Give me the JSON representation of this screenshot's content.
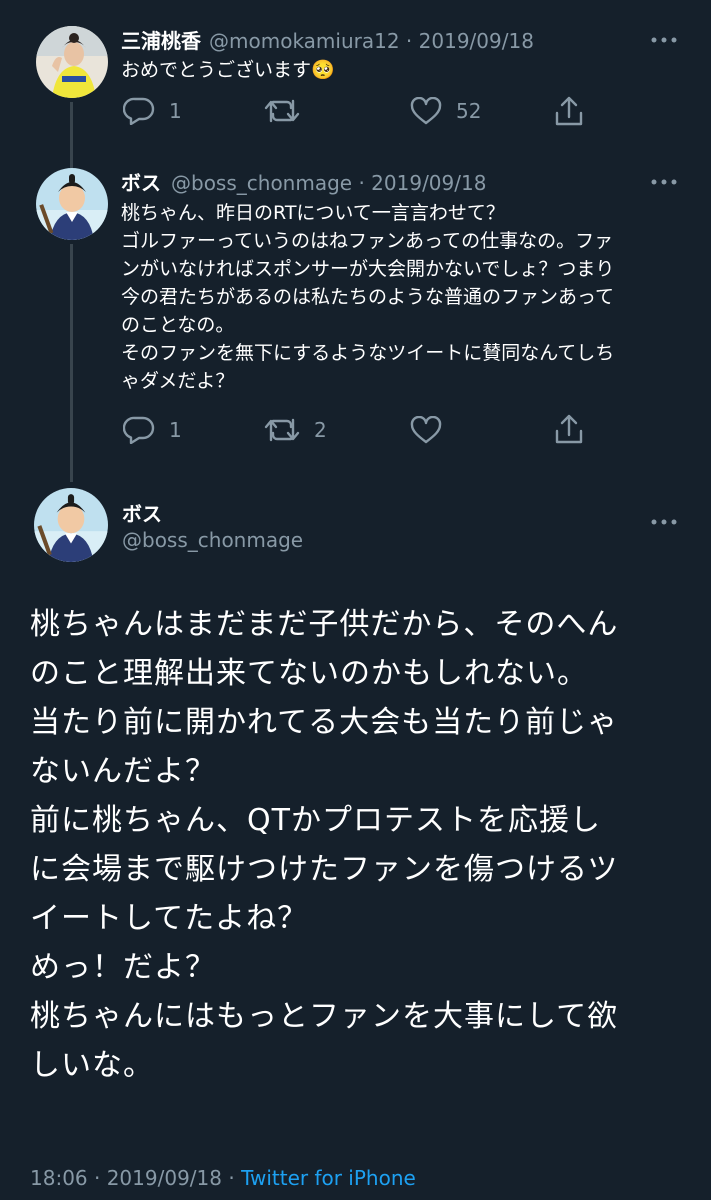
{
  "tweet1": {
    "display_name": "三浦桃香",
    "handle_date": "@momokamiura12 · 2019/09/18",
    "text": "おめでとうございます🥺",
    "reply_count": "1",
    "retweet_count": "",
    "like_count": "52"
  },
  "tweet2": {
    "display_name": "ボス",
    "handle_date": "@boss_chonmage · 2019/09/18",
    "lines": [
      "桃ちゃん、昨日のRTについて一言言わせて？",
      "ゴルファーっていうのはねファンあっての仕事なの。ファ",
      "ンがいなければスポンサーが大会開かないでしょ？つまり",
      "今の君たちがあるのは私たちのような普通のファンあって",
      "のことなの。",
      "そのファンを無下にするようなツイートに賛同なんてしち",
      "ゃダメだよ？"
    ],
    "reply_count": "1",
    "retweet_count": "2",
    "like_count": ""
  },
  "main_tweet": {
    "display_name": "ボス",
    "handle": "@boss_chonmage",
    "lines": [
      "桃ちゃんはまだまだ子供だから、そのへん",
      "のこと理解出来てないのかもしれない。",
      "当たり前に開かれてる大会も当たり前じゃ",
      "ないんだよ？",
      "前に桃ちゃん、QTかプロテストを応援し",
      "に会場まで駆けつけたファンを傷つけるツ",
      "イートしてたよね？",
      "めっ！だよ？",
      "桃ちゃんにはもっとファンを大事にして欲",
      "しいな。"
    ],
    "time_date": "18:06 · 2019/09/18 · ",
    "source": "Twitter for iPhone"
  },
  "icons": {
    "reply": "reply-icon",
    "retweet": "retweet-icon",
    "like": "heart-icon",
    "share": "share-icon",
    "more": "more-icon"
  },
  "colors": {
    "background": "#15202b",
    "secondary_text": "#8899a6",
    "link": "#1da1f2",
    "thread_line": "#38444d"
  }
}
